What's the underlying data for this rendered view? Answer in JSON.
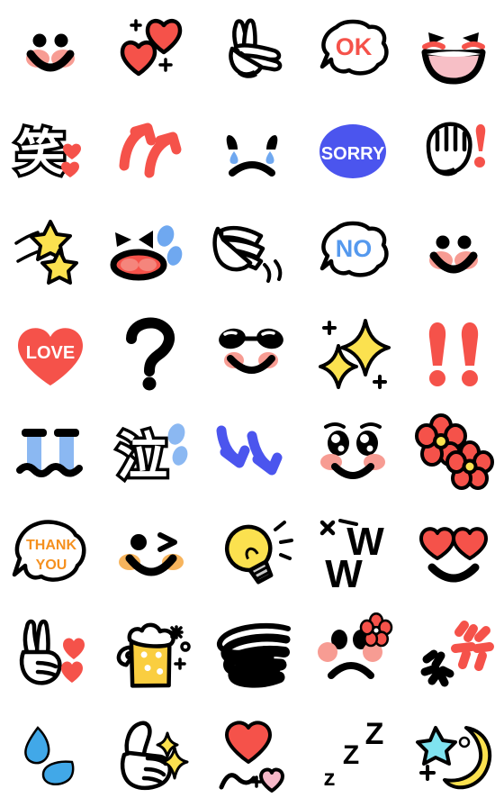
{
  "sheet": {
    "title": "Emoji Sticker Sheet",
    "background": "#ffffff",
    "columns": 5,
    "rows": 8,
    "cell_size": 112
  },
  "palette": {
    "black": "#000000",
    "white": "#ffffff",
    "red": "#F5524A",
    "red_deep": "#E8413A",
    "pink_cheek": "#F79C93",
    "pink_light": "#F6B8C8",
    "pink_mouth": "#F7BFC6",
    "blue": "#4B55EE",
    "blue_light": "#6FA8F0",
    "blue_sky": "#5599EE",
    "blue_tear": "#8BB8F2",
    "yellow": "#FBE14F",
    "yellow_deep": "#F7D84A",
    "orange": "#F5901E",
    "orange_cheek": "#F7B45C",
    "cyan": "#7FE3F0",
    "grey": "#C9C9C9",
    "beer": "#FACE40"
  },
  "stickers": [
    {
      "row": 1,
      "col": 1,
      "name": "smiley-blush-face",
      "label": "Smiling face with pink cheeks"
    },
    {
      "row": 1,
      "col": 2,
      "name": "two-hearts",
      "label": "Two red hearts with sparkles"
    },
    {
      "row": 1,
      "col": 3,
      "name": "peace-hand",
      "label": "White peace / victory hand"
    },
    {
      "row": 1,
      "col": 4,
      "name": "ok-speech-bubble",
      "label": "OK",
      "text": "OK",
      "text_color": "#F5524A"
    },
    {
      "row": 1,
      "col": 5,
      "name": "laughing-open-mouth-face",
      "label": "Laughing face with open mouth"
    },
    {
      "row": 2,
      "col": 1,
      "name": "kanji-warau",
      "label": "Kanji laugh with hearts",
      "text": "笑"
    },
    {
      "row": 2,
      "col": 2,
      "name": "red-double-arrow-up",
      "label": "Two red up arrows"
    },
    {
      "row": 2,
      "col": 3,
      "name": "crying-sad-face",
      "label": "Sad crying face with tears"
    },
    {
      "row": 2,
      "col": 4,
      "name": "sorry-badge",
      "label": "SORRY",
      "text": "SORRY",
      "text_color": "#ffffff",
      "fill": "#4B55EE"
    },
    {
      "row": 2,
      "col": 5,
      "name": "fist-exclamation",
      "label": "White fist with red exclamation"
    },
    {
      "row": 3,
      "col": 1,
      "name": "shooting-stars",
      "label": "Two yellow shooting stars"
    },
    {
      "row": 3,
      "col": 2,
      "name": "frustrated-face-sweat",
      "label": "Frustrated face with sweat drops"
    },
    {
      "row": 3,
      "col": 3,
      "name": "waving-hand",
      "label": "White waving hand with motion lines"
    },
    {
      "row": 3,
      "col": 4,
      "name": "no-speech-bubble",
      "label": "NO",
      "text": "NO",
      "text_color": "#5599EE"
    },
    {
      "row": 3,
      "col": 5,
      "name": "smiley-blush-face-2",
      "label": "Smiling face with pink cheeks"
    },
    {
      "row": 4,
      "col": 1,
      "name": "love-heart",
      "label": "LOVE",
      "text": "LOVE",
      "text_color": "#ffffff",
      "fill": "#F5524A"
    },
    {
      "row": 4,
      "col": 2,
      "name": "question-mark",
      "label": "Black question mark"
    },
    {
      "row": 4,
      "col": 3,
      "name": "sunglasses-face",
      "label": "Face with sunglasses"
    },
    {
      "row": 4,
      "col": 4,
      "name": "sparkles",
      "label": "Yellow sparkle stars"
    },
    {
      "row": 4,
      "col": 5,
      "name": "double-exclamation",
      "label": "Two red exclamation marks"
    },
    {
      "row": 5,
      "col": 1,
      "name": "bawling-face",
      "label": "Face with streaming blue tears"
    },
    {
      "row": 5,
      "col": 2,
      "name": "kanji-naku",
      "label": "Kanji cry with tears",
      "text": "泣"
    },
    {
      "row": 5,
      "col": 3,
      "name": "blue-down-arrows",
      "label": "Blue downward arrows"
    },
    {
      "row": 5,
      "col": 4,
      "name": "teary-happy-face",
      "label": "Happy face with sparkly eyes"
    },
    {
      "row": 5,
      "col": 5,
      "name": "red-flowers",
      "label": "Two red flowers"
    },
    {
      "row": 6,
      "col": 1,
      "name": "thank-you-bubble",
      "label": "THANK YOU",
      "text_line1": "THANK",
      "text_line2": "YOU",
      "text_color": "#F5901E"
    },
    {
      "row": 6,
      "col": 2,
      "name": "winking-face",
      "label": "Winking face with orange cheeks"
    },
    {
      "row": 6,
      "col": 3,
      "name": "light-bulb",
      "label": "Yellow light bulb idea"
    },
    {
      "row": 6,
      "col": 4,
      "name": "www-laugh-text",
      "label": "WW laugh text",
      "text": "ww"
    },
    {
      "row": 6,
      "col": 5,
      "name": "heart-eyes-face",
      "label": "Face with heart eyes"
    },
    {
      "row": 7,
      "col": 1,
      "name": "peace-hand-hearts",
      "label": "Peace hand with red hearts"
    },
    {
      "row": 7,
      "col": 2,
      "name": "beer-mug",
      "label": "Beer mug with sparkles"
    },
    {
      "row": 7,
      "col": 3,
      "name": "scribble-swirl",
      "label": "Black scribble swirl"
    },
    {
      "row": 7,
      "col": 4,
      "name": "sad-face-flower",
      "label": "Sad face with red flower"
    },
    {
      "row": 7,
      "col": 5,
      "name": "red-black-confetti",
      "label": "Red and black confetti burst"
    },
    {
      "row": 8,
      "col": 1,
      "name": "blue-sweat-drops",
      "label": "Two blue sweat drops"
    },
    {
      "row": 8,
      "col": 2,
      "name": "thumbs-up",
      "label": "White thumbs up with sparkle"
    },
    {
      "row": 8,
      "col": 3,
      "name": "heart-balloon-string",
      "label": "Heart balloon on a string"
    },
    {
      "row": 8,
      "col": 4,
      "name": "sleeping-zzz",
      "label": "Sleeping Zzz",
      "text": "zZZ"
    },
    {
      "row": 8,
      "col": 5,
      "name": "crescent-moon-star",
      "label": "Crescent moon with star"
    }
  ]
}
